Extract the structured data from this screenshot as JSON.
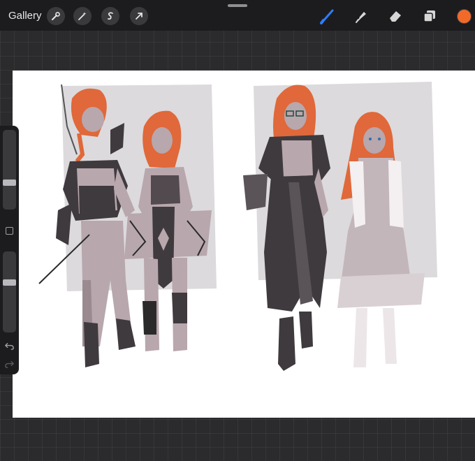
{
  "topbar": {
    "gallery_label": "Gallery",
    "left_tools": [
      "wrench-icon",
      "magic-wand-icon",
      "selection-s-icon",
      "transform-arrow-icon"
    ],
    "right_tools": [
      "brush-icon",
      "smudge-icon",
      "eraser-icon",
      "layers-icon"
    ],
    "active_tool": "brush-icon",
    "accent_color": "#2f7cf6",
    "current_color": "#f26a2a"
  },
  "sidebar": {
    "brush_size_level": 0.68,
    "opacity_level": 0.37,
    "icons": [
      "modify-square-icon",
      "undo-icon",
      "redo-icon"
    ]
  },
  "canvas": {
    "content": "character-sketches-artwork",
    "colors": {
      "hair": "#e0683a",
      "skin": "#b8a7ad",
      "dark_cloth": "#3f3a3e",
      "backdrop": "#dcdadc"
    }
  }
}
